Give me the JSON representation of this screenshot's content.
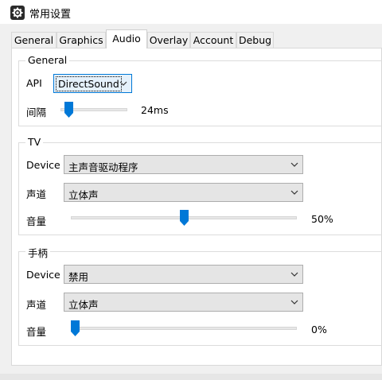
{
  "window": {
    "title": "常用设置",
    "icon": "gear-icon"
  },
  "tabs": [
    {
      "label": "General"
    },
    {
      "label": "Graphics"
    },
    {
      "label": "Audio",
      "active": true
    },
    {
      "label": "Overlay"
    },
    {
      "label": "Account"
    },
    {
      "label": "Debug"
    }
  ],
  "general": {
    "title": "General",
    "api_label": "API",
    "api_value": "DirectSound",
    "interval_label": "间隔",
    "interval_value": "24ms"
  },
  "tv": {
    "title": "TV",
    "device_label": "Device",
    "device_value": "主声音驱动程序",
    "channel_label": "声道",
    "channel_value": "立体声",
    "volume_label": "音量",
    "volume_value": "50%",
    "volume_level": 0.5
  },
  "controller": {
    "title": "手柄",
    "device_label": "Device",
    "device_value": "禁用",
    "channel_label": "声道",
    "channel_value": "立体声",
    "volume_label": "音量",
    "volume_value": "0%",
    "volume_level": 0
  },
  "colors": {
    "accent": "#0078d7"
  }
}
